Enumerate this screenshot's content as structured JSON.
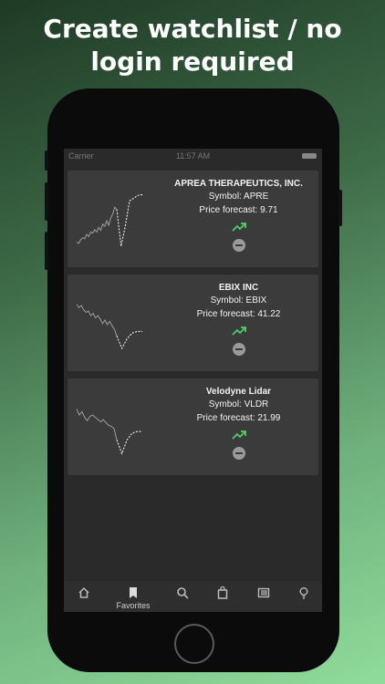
{
  "headline": {
    "line1": "Create watchlist / no",
    "line2": "login required"
  },
  "status_bar": {
    "carrier": "Carrier",
    "time": "11:57 AM"
  },
  "stocks": [
    {
      "company": "APREA THERAPEUTICS, INC.",
      "symbol": "Symbol: APRE",
      "forecast": "Price forecast: 9.71",
      "trend_icon": "trending-up-icon",
      "history": [
        0.12,
        0.1,
        0.16,
        0.2,
        0.18,
        0.26,
        0.22,
        0.3,
        0.28,
        0.34,
        0.3,
        0.38,
        0.33,
        0.44,
        0.4,
        0.5,
        0.42,
        0.55,
        0.62,
        0.74,
        0.7
      ],
      "forecast_series": [
        0.7,
        0.05,
        0.4,
        0.85,
        0.9,
        0.95,
        0.96
      ]
    },
    {
      "company": "EBIX INC",
      "symbol": "Symbol: EBIX",
      "forecast": "Price forecast: 41.22",
      "trend_icon": "trending-up-icon",
      "history": [
        0.86,
        0.8,
        0.84,
        0.76,
        0.72,
        0.74,
        0.66,
        0.7,
        0.62,
        0.66,
        0.6,
        0.52,
        0.58,
        0.5,
        0.56,
        0.48,
        0.42,
        0.3
      ],
      "forecast_series": [
        0.3,
        0.08,
        0.25,
        0.35,
        0.38,
        0.38
      ]
    },
    {
      "company": "Velodyne Lidar",
      "symbol": "Symbol: VLDR",
      "forecast": "Price forecast: 21.99",
      "trend_icon": "trending-up-icon",
      "history": [
        0.85,
        0.74,
        0.8,
        0.7,
        0.64,
        0.72,
        0.74,
        0.7,
        0.66,
        0.62,
        0.66,
        0.6,
        0.56,
        0.54,
        0.5,
        0.3
      ],
      "forecast_series": [
        0.3,
        0.06,
        0.3,
        0.42,
        0.45,
        0.45
      ]
    }
  ],
  "tabs": [
    {
      "name": "home-icon",
      "label": ""
    },
    {
      "name": "bookmark-icon",
      "label": "Favorites"
    },
    {
      "name": "search-icon",
      "label": ""
    },
    {
      "name": "shopping-bag-icon",
      "label": ""
    },
    {
      "name": "list-icon",
      "label": ""
    },
    {
      "name": "lightbulb-icon",
      "label": ""
    }
  ],
  "colors": {
    "forecast_line": "#ffffff",
    "history_line": "#9e9e9e",
    "trend_up": "#4fcf6a"
  }
}
